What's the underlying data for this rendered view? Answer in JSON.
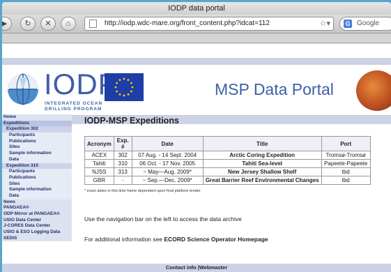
{
  "browser": {
    "window_title": "IODP data portal",
    "url": "http://iodp.wdc-mare.org/front_content.php?idcat=112",
    "search_placeholder": "Google"
  },
  "header": {
    "logo_text": "IODP",
    "logo_subtitle": "INTEGRATED OCEAN DRILLING PROGRAM",
    "portal_title": "MSP Data Portal"
  },
  "sidebar": {
    "items": [
      {
        "label": "Home",
        "level": 0
      },
      {
        "label": "Expeditions",
        "level": 0,
        "selected": true
      },
      {
        "label": "Expedition 302",
        "level": 1
      },
      {
        "label": "Participants",
        "level": 2
      },
      {
        "label": "Publications",
        "level": 2
      },
      {
        "label": "Sites",
        "level": 2
      },
      {
        "label": "Sample information",
        "level": 2
      },
      {
        "label": "Data",
        "level": 2
      },
      {
        "label": "Expedition 310",
        "level": 1
      },
      {
        "label": "Participants",
        "level": 2
      },
      {
        "label": "Publications",
        "level": 2
      },
      {
        "label": "Sites",
        "level": 2
      },
      {
        "label": "Sample information",
        "level": 2
      },
      {
        "label": "Data",
        "level": 2
      },
      {
        "label": "News",
        "level": 0
      },
      {
        "label": "PANGAEA®",
        "level": 0
      },
      {
        "label": "ODP Mirror at PANGAEA®",
        "level": 0
      },
      {
        "label": "USIO Data Center",
        "level": 0
      },
      {
        "label": "J-CORES Data Center",
        "level": 0
      },
      {
        "label": "USIO & ESO Logging Data",
        "level": 0
      },
      {
        "label": "SEDIS",
        "level": 0
      }
    ]
  },
  "main": {
    "heading": "IODP-MSP Expeditions",
    "table": {
      "headers": [
        "Acronym",
        "Exp. #",
        "Date",
        "Title",
        "Port"
      ],
      "rows": [
        [
          "ACEX",
          "302",
          "07 Aug. - 14 Sept. 2004",
          "Arctic Coring Expedition",
          "Tromsø-Tromsø"
        ],
        [
          "Tahiti",
          "310",
          "06 Oct. - 17 Nov. 2005",
          "Tahiti Sea-level",
          "Papeete-Papeete"
        ],
        [
          "NJSS",
          "313",
          "~ May—Aug. 2009*",
          "New Jersey Shallow Shelf",
          "tbd"
        ],
        [
          "GBR",
          "-",
          "~ Sep.—Dec. 2009*",
          "Great Barrier Reef Environmental Changes",
          "tbd"
        ]
      ]
    },
    "footnote": "* exact dates in this time frame dependent upon final platform tender",
    "nav_hint": "Use the navigation bar on the left to access the data archive",
    "info_prefix": "For additional information see ",
    "info_link": "ECORD Science Operator Homepage"
  },
  "footer": {
    "contact": "Contact info",
    "webmaster": "Webmaster"
  },
  "colors": {
    "brand_blue": "#3f5ea8",
    "band": "#cdd3e7",
    "nav_text": "#1f2f6b"
  }
}
